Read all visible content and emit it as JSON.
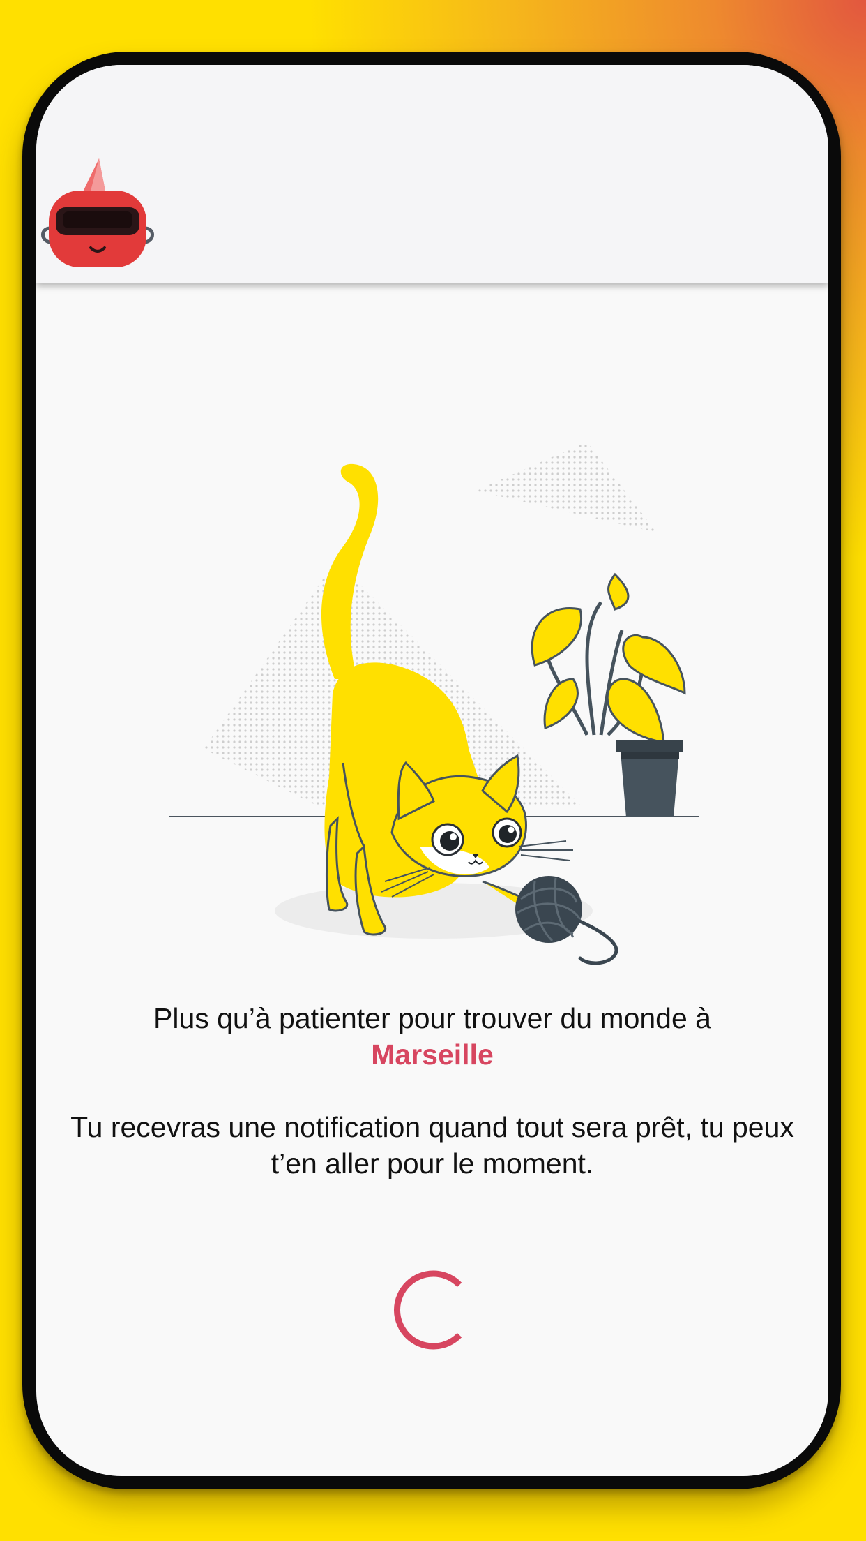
{
  "colors": {
    "accent": "#d74660",
    "cat_yellow": "#ffe000",
    "screen_bg": "#f9f9f9",
    "pot": "#46535d"
  },
  "header": {
    "avatar_icon": "red-robot-vr-mascot-icon"
  },
  "illustration": {
    "icon": "cat-playing-with-yarn-illustration"
  },
  "message": {
    "waiting_text": "Plus qu’à patienter pour trouver du monde à",
    "city": "Marseille",
    "notification_text": "Tu recevras une notification quand tout sera prêt, tu peux t’en aller pour le moment."
  },
  "loader": {
    "icon": "loading-spinner-icon"
  }
}
